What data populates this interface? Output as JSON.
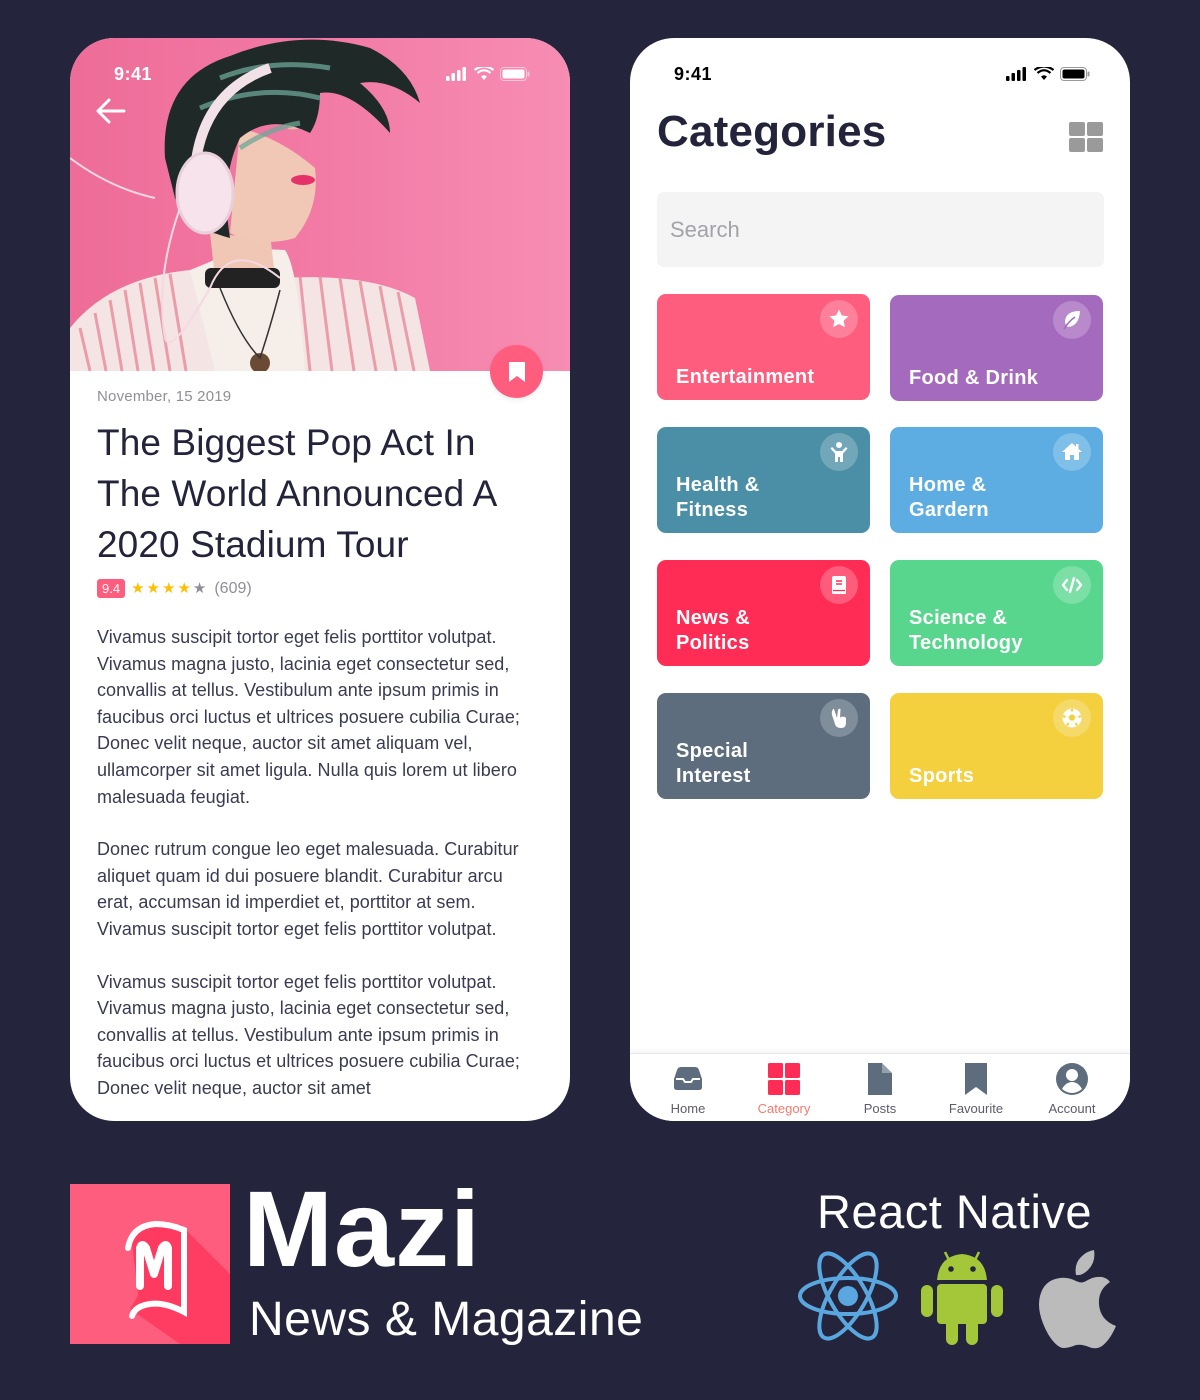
{
  "status_bar": {
    "time": "9:41"
  },
  "article": {
    "date": "November, 15 2019",
    "title": "The Biggest Pop Act In The World Announced A 2020 Stadium Tour",
    "rating": {
      "score": "9.4",
      "stars": 4,
      "max_stars": 5,
      "count": "(609)"
    },
    "paragraphs": [
      "Vivamus suscipit tortor eget felis porttitor volutpat. Vivamus magna justo, lacinia eget consectetur sed, convallis at tellus. Vestibulum ante ipsum primis in faucibus orci luctus et ultrices posuere cubilia Curae; Donec velit neque, auctor sit amet aliquam vel, ullamcorper sit amet ligula. Nulla quis lorem ut libero malesuada feugiat.",
      "Donec rutrum congue leo eget malesuada. Curabitur aliquet quam id dui posuere blandit. Curabitur arcu erat, accumsan id imperdiet et, porttitor at sem. Vivamus suscipit tortor eget felis porttitor volutpat.",
      "Vivamus suscipit tortor eget felis porttitor volutpat. Vivamus magna justo, lacinia eget consectetur sed, convallis at tellus. Vestibulum ante ipsum primis in faucibus orci luctus et ultrices posuere cubilia Curae; Donec velit neque, auctor sit amet"
    ],
    "accent_color": "#ff5d7e"
  },
  "categories_screen": {
    "title": "Categories",
    "search": {
      "placeholder": "Search",
      "value": ""
    },
    "categories": [
      {
        "label": "Entertainment",
        "icon": "star-icon",
        "color": "#ff5d7e"
      },
      {
        "label": "Food & Drink",
        "icon": "leaf-icon",
        "color": "#a46abd"
      },
      {
        "label": "Health &\nFitness",
        "icon": "person-icon",
        "color": "#4a8fa6"
      },
      {
        "label": "Home &\nGardern",
        "icon": "home-icon",
        "color": "#5dade2"
      },
      {
        "label": "News &\nPolitics",
        "icon": "book-icon",
        "color": "#ff2d55"
      },
      {
        "label": "Science &\nTechnology",
        "icon": "code-icon",
        "color": "#58d68d"
      },
      {
        "label": "Special\nInterest",
        "icon": "hand-icon",
        "color": "#5d6d7e"
      },
      {
        "label": "Sports",
        "icon": "soccer-ball-icon",
        "color": "#f4d03f"
      }
    ],
    "tab_bar": {
      "active_index": 1,
      "active_color": "#ff2d55",
      "tabs": [
        {
          "label": "Home",
          "icon": "inbox-icon"
        },
        {
          "label": "Category",
          "icon": "grid-icon"
        },
        {
          "label": "Posts",
          "icon": "document-icon"
        },
        {
          "label": "Favourite",
          "icon": "bookmark-icon"
        },
        {
          "label": "Account",
          "icon": "account-icon"
        }
      ]
    }
  },
  "branding": {
    "name": "Mazi",
    "tagline": "News & Magazine",
    "tech": "React Native",
    "platforms": [
      "react-icon",
      "android-icon",
      "apple-icon"
    ],
    "logo_color": "#ff5d7e"
  }
}
